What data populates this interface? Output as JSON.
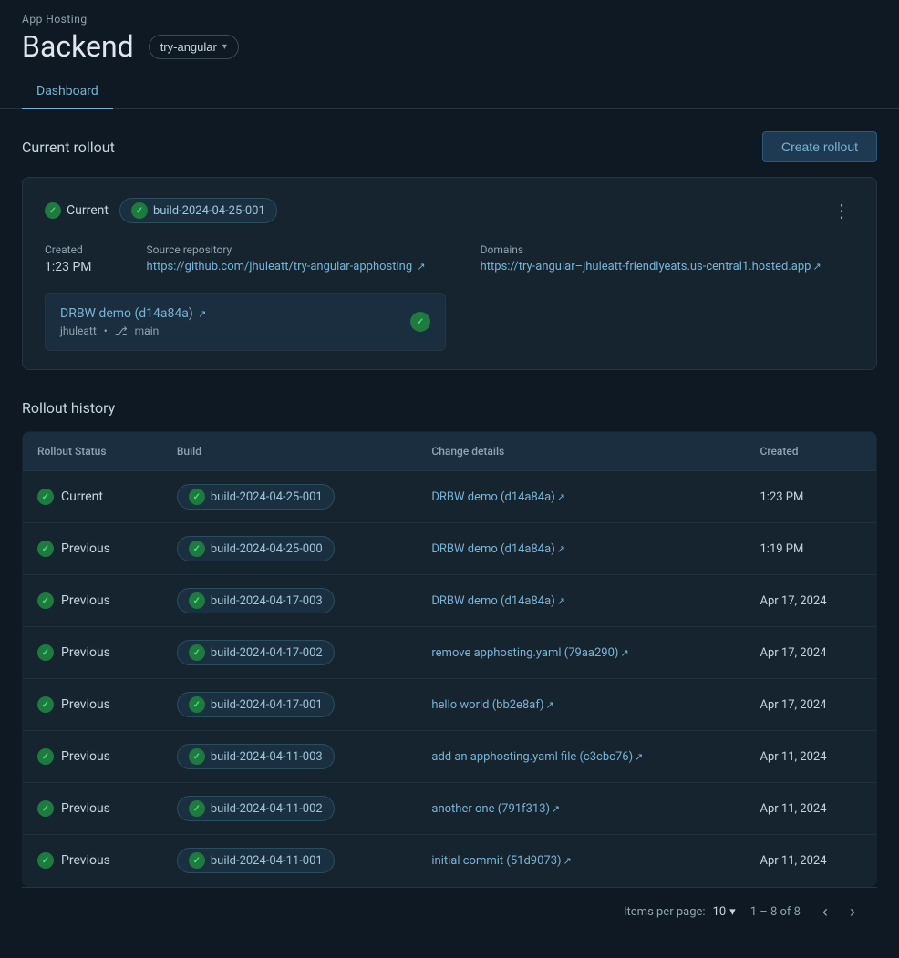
{
  "header": {
    "app_hosting_label": "App Hosting",
    "backend_title": "Backend",
    "branch_selector": {
      "label": "try-angular",
      "chevron": "▾"
    }
  },
  "tabs": [
    {
      "label": "Dashboard",
      "active": true
    }
  ],
  "current_rollout": {
    "section_title": "Current rollout",
    "create_button_label": "Create rollout",
    "status_label": "Current",
    "build_label": "build-2024-04-25-001",
    "created_label": "Created",
    "created_value": "1:23 PM",
    "source_repo_label": "Source repository",
    "source_repo_url": "https://github.com/jhuleatt/try-angular-apphosting",
    "source_repo_display": "https://github.com/jhuleatt/try-angular-apphosting ",
    "domains_label": "Domains",
    "domain_url": "https://try-angular–jhuleatt-friendlyeats.us-central1.hosted.app",
    "domain_display": "https://try-angular–jhuleatt-friendlyeats.us-central1.hosted.app",
    "commit_link_text": "DRBW demo (d14a84a)",
    "commit_user": "jhuleatt",
    "commit_branch": "main"
  },
  "rollout_history": {
    "section_title": "Rollout history",
    "columns": [
      "Rollout Status",
      "Build",
      "Change details",
      "Created"
    ],
    "rows": [
      {
        "status": "Current",
        "build": "build-2024-04-25-001",
        "change_details": "DRBW demo (d14a84a)",
        "change_url": "#",
        "created": "1:23 PM"
      },
      {
        "status": "Previous",
        "build": "build-2024-04-25-000",
        "change_details": "DRBW demo (d14a84a)",
        "change_url": "#",
        "created": "1:19 PM"
      },
      {
        "status": "Previous",
        "build": "build-2024-04-17-003",
        "change_details": "DRBW demo (d14a84a)",
        "change_url": "#",
        "created": "Apr 17, 2024"
      },
      {
        "status": "Previous",
        "build": "build-2024-04-17-002",
        "change_details": "remove apphosting.yaml (79aa290)",
        "change_url": "#",
        "created": "Apr 17, 2024"
      },
      {
        "status": "Previous",
        "build": "build-2024-04-17-001",
        "change_details": "hello world (bb2e8af)",
        "change_url": "#",
        "created": "Apr 17, 2024"
      },
      {
        "status": "Previous",
        "build": "build-2024-04-11-003",
        "change_details": "add an apphosting.yaml file (c3cbc76)",
        "change_url": "#",
        "created": "Apr 11, 2024"
      },
      {
        "status": "Previous",
        "build": "build-2024-04-11-002",
        "change_details": "another one (791f313)",
        "change_url": "#",
        "created": "Apr 11, 2024"
      },
      {
        "status": "Previous",
        "build": "build-2024-04-11-001",
        "change_details": "initial commit (51d9073)",
        "change_url": "#",
        "created": "Apr 11, 2024"
      }
    ]
  },
  "pagination": {
    "items_per_page_label": "Items per page:",
    "items_per_page_value": "10",
    "page_range": "1 – 8 of 8"
  }
}
